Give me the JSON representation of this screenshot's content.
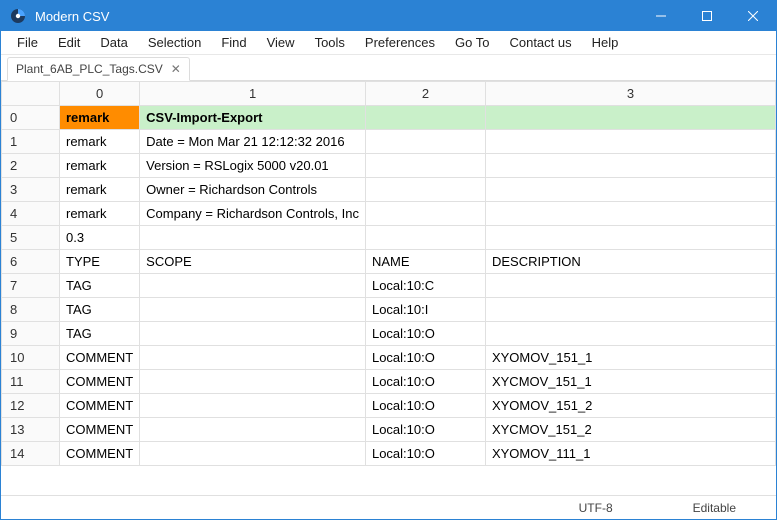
{
  "window": {
    "title": "Modern CSV"
  },
  "menu": [
    "File",
    "Edit",
    "Data",
    "Selection",
    "Find",
    "View",
    "Tools",
    "Preferences",
    "Go To",
    "Contact us",
    "Help"
  ],
  "tab": {
    "label": "Plant_6AB_PLC_Tags.CSV"
  },
  "columns": [
    "0",
    "1",
    "2",
    "3"
  ],
  "rows": [
    {
      "idx": "0",
      "hl": true,
      "c": [
        "remark",
        "CSV-Import-Export",
        "",
        ""
      ]
    },
    {
      "idx": "1",
      "hl": false,
      "c": [
        "remark",
        "Date = Mon Mar 21 12:12:32 2016",
        "",
        ""
      ]
    },
    {
      "idx": "2",
      "hl": false,
      "c": [
        "remark",
        "Version = RSLogix 5000 v20.01",
        "",
        ""
      ]
    },
    {
      "idx": "3",
      "hl": false,
      "c": [
        "remark",
        "Owner = Richardson Controls",
        "",
        ""
      ]
    },
    {
      "idx": "4",
      "hl": false,
      "c": [
        "remark",
        "Company = Richardson Controls, Inc",
        "",
        ""
      ]
    },
    {
      "idx": "5",
      "hl": false,
      "c": [
        "0.3",
        "",
        "",
        ""
      ]
    },
    {
      "idx": "6",
      "hl": false,
      "c": [
        "TYPE",
        "SCOPE",
        "NAME",
        "DESCRIPTION"
      ]
    },
    {
      "idx": "7",
      "hl": false,
      "c": [
        "TAG",
        "",
        "Local:10:C",
        ""
      ]
    },
    {
      "idx": "8",
      "hl": false,
      "c": [
        "TAG",
        "",
        "Local:10:I",
        ""
      ]
    },
    {
      "idx": "9",
      "hl": false,
      "c": [
        "TAG",
        "",
        "Local:10:O",
        ""
      ]
    },
    {
      "idx": "10",
      "hl": false,
      "c": [
        "COMMENT",
        "",
        "Local:10:O",
        "XYOMOV_151_1"
      ]
    },
    {
      "idx": "11",
      "hl": false,
      "c": [
        "COMMENT",
        "",
        "Local:10:O",
        "XYCMOV_151_1"
      ]
    },
    {
      "idx": "12",
      "hl": false,
      "c": [
        "COMMENT",
        "",
        "Local:10:O",
        "XYOMOV_151_2"
      ]
    },
    {
      "idx": "13",
      "hl": false,
      "c": [
        "COMMENT",
        "",
        "Local:10:O",
        "XYCMOV_151_2"
      ]
    },
    {
      "idx": "14",
      "hl": false,
      "c": [
        "COMMENT",
        "",
        "Local:10:O",
        "XYOMOV_111_1"
      ]
    }
  ],
  "status": {
    "encoding": "UTF-8",
    "mode": "Editable"
  }
}
